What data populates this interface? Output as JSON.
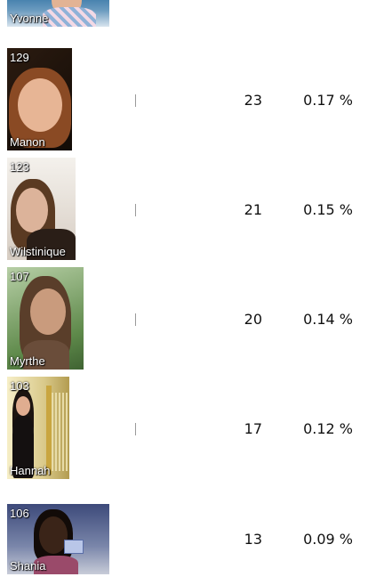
{
  "rows": [
    {
      "id": "",
      "name": "Yvonne",
      "votes": "",
      "percent": "",
      "share": null,
      "bg": [
        "#2a6ea0",
        "#c9d9e6"
      ],
      "skin": "#e2b394",
      "hair": "#6b4a2e"
    },
    {
      "id": "129",
      "name": "Manon",
      "votes": "23",
      "percent": "0.17 %",
      "share": 0.17,
      "bg": [
        "#1a120c",
        "#3a2718"
      ],
      "skin": "#e7b595",
      "hair": "#8a4a24"
    },
    {
      "id": "123",
      "name": "Wilstinique",
      "votes": "21",
      "percent": "0.15 %",
      "share": 0.15,
      "bg": [
        "#f2efea",
        "#d8cfc6"
      ],
      "skin": "#dcb39a",
      "hair": "#5a3a22"
    },
    {
      "id": "107",
      "name": "Myrthe",
      "votes": "20",
      "percent": "0.14 %",
      "share": 0.14,
      "bg": [
        "#8fb37a",
        "#4f7a3e"
      ],
      "skin": "#c99b7d",
      "hair": "#4e3524"
    },
    {
      "id": "103",
      "name": "Hannah",
      "votes": "17",
      "percent": "0.12 %",
      "share": 0.12,
      "bg": [
        "#f2e7b8",
        "#b9a35a"
      ],
      "skin": "#e0ad90",
      "hair": "#1c1410"
    },
    {
      "id": "106",
      "name": "Shania",
      "votes": "13",
      "percent": "0.09 %",
      "share": 0.09,
      "bg": [
        "#4c5a88",
        "#c7ccd8"
      ],
      "skin": "#3a2418",
      "hair": "#120b08"
    }
  ]
}
